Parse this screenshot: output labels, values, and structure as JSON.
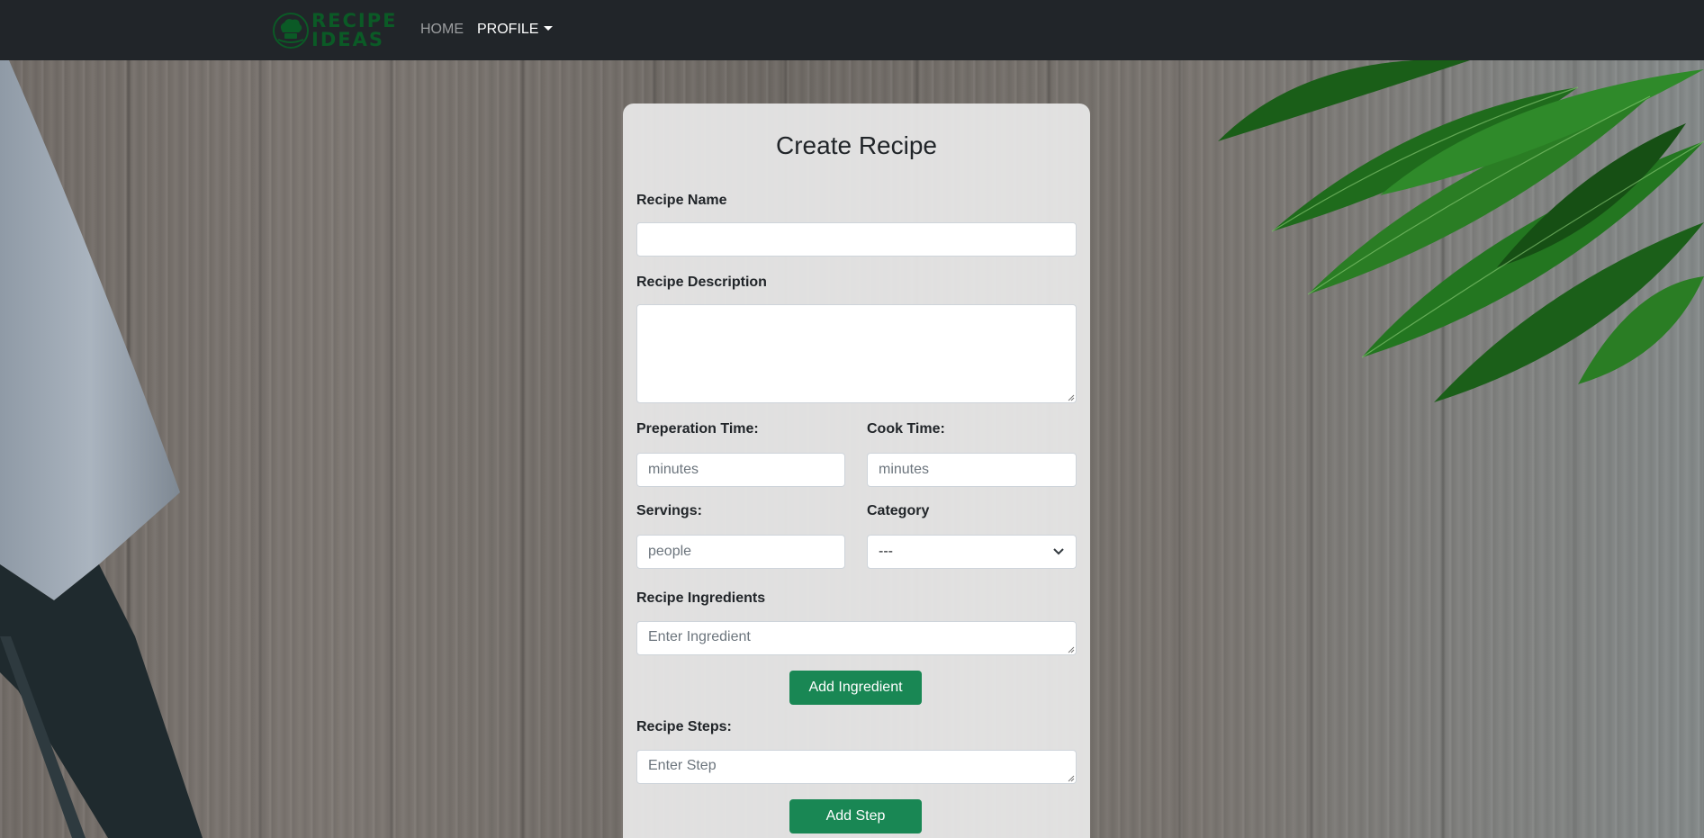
{
  "navbar": {
    "brand_line1": "RECIPE",
    "brand_line2": "IDEAS",
    "home_label": "HOME",
    "profile_label": "PROFILE"
  },
  "form": {
    "title": "Create Recipe",
    "recipe_name_label": "Recipe Name",
    "recipe_name_value": "",
    "description_label": "Recipe Description",
    "description_value": "",
    "prep_time_label": "Preperation Time:",
    "prep_time_placeholder": "minutes",
    "cook_time_label": "Cook Time:",
    "cook_time_placeholder": "minutes",
    "servings_label": "Servings:",
    "servings_placeholder": "people",
    "category_label": "Category",
    "category_selected": "---",
    "ingredients_label": "Recipe Ingredients",
    "ingredient_placeholder": "Enter Ingredient",
    "add_ingredient_label": "Add Ingredient",
    "steps_label": "Recipe Steps:",
    "step_placeholder": "Enter Step",
    "add_step_label": "Add Step"
  },
  "colors": {
    "navbar_bg": "#212529",
    "brand_green": "#0b5a26",
    "button_green": "#198754"
  },
  "icons": {
    "brand": "chef-hat-icon",
    "select_arrow": "chevron-down-icon"
  }
}
